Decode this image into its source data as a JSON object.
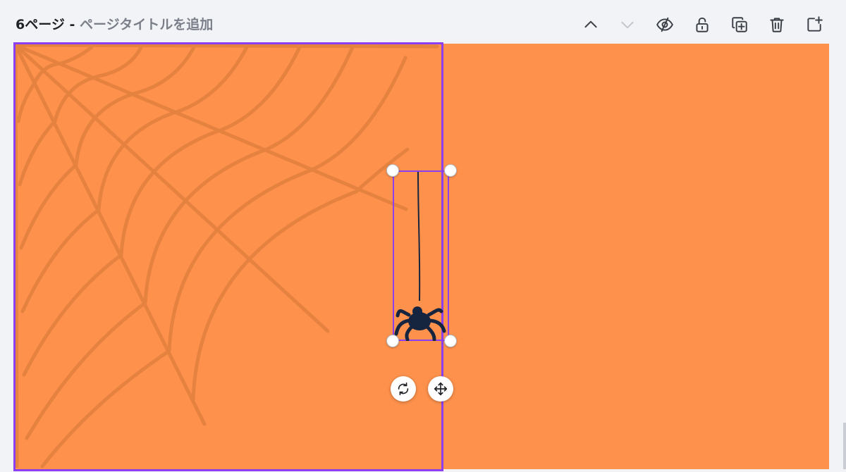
{
  "header": {
    "page_number": "6ページ",
    "separator": " - ",
    "title_placeholder": "ページタイトルを追加"
  },
  "toolbar": {
    "buttons": [
      {
        "name": "move-up",
        "icon": "chevron-up-icon",
        "enabled": true
      },
      {
        "name": "move-down",
        "icon": "chevron-down-icon",
        "enabled": false
      },
      {
        "name": "hide-page",
        "icon": "eye-slash-icon",
        "enabled": true
      },
      {
        "name": "lock-page",
        "icon": "unlocked-padlock-icon",
        "enabled": true
      },
      {
        "name": "duplicate-page",
        "icon": "duplicate-icon",
        "enabled": true
      },
      {
        "name": "delete-page",
        "icon": "trash-icon",
        "enabled": true
      },
      {
        "name": "add-page",
        "icon": "add-page-icon",
        "enabled": true
      }
    ]
  },
  "canvas": {
    "background_color": "#fe914c",
    "web_color": "#e5823f",
    "selection_color": "#8b3ff0",
    "spider_color": "#16253f",
    "elements": [
      {
        "name": "spider-web-graphic",
        "icon": "spider-web-icon"
      },
      {
        "name": "hanging-spider-graphic",
        "icon": "spider-icon",
        "selected": true
      }
    ]
  },
  "selection_controls": {
    "rotate": {
      "icon": "rotate-icon"
    },
    "move": {
      "icon": "move-arrows-icon"
    }
  }
}
